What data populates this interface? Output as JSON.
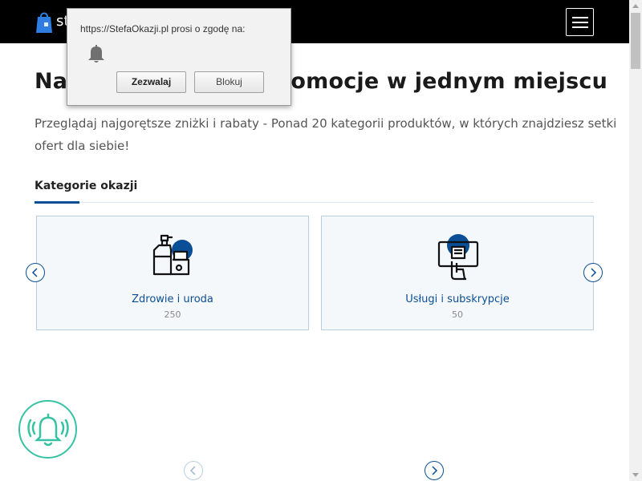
{
  "header": {
    "logo_text": "st",
    "background": "#000000"
  },
  "main": {
    "headline": "Najlepsze okazje i promocje w jednym miejscu",
    "subtext": "Przeglądaj najgorętsze zniżki i rabaty - Ponad 20 kategorii produktów, w których znajdziesz setki ofert dla siebie!",
    "section_title": "Kategorie okazji",
    "accent_color": "#0a4e96",
    "cards": [
      {
        "title": "Zdrowie i uroda",
        "count": "250",
        "icon": "cosmetics-icon"
      },
      {
        "title": "Usługi i subskrypcje",
        "count": "50",
        "icon": "subscription-icon"
      }
    ]
  },
  "popup": {
    "text": "https://StefaOkazji.pl prosi o zgodę na:",
    "allow_label": "Zezwalaj",
    "block_label": "Blokuj",
    "icon": "bell-icon"
  },
  "widget": {
    "icon": "ringing-bell-icon",
    "color": "#37c3a3"
  }
}
